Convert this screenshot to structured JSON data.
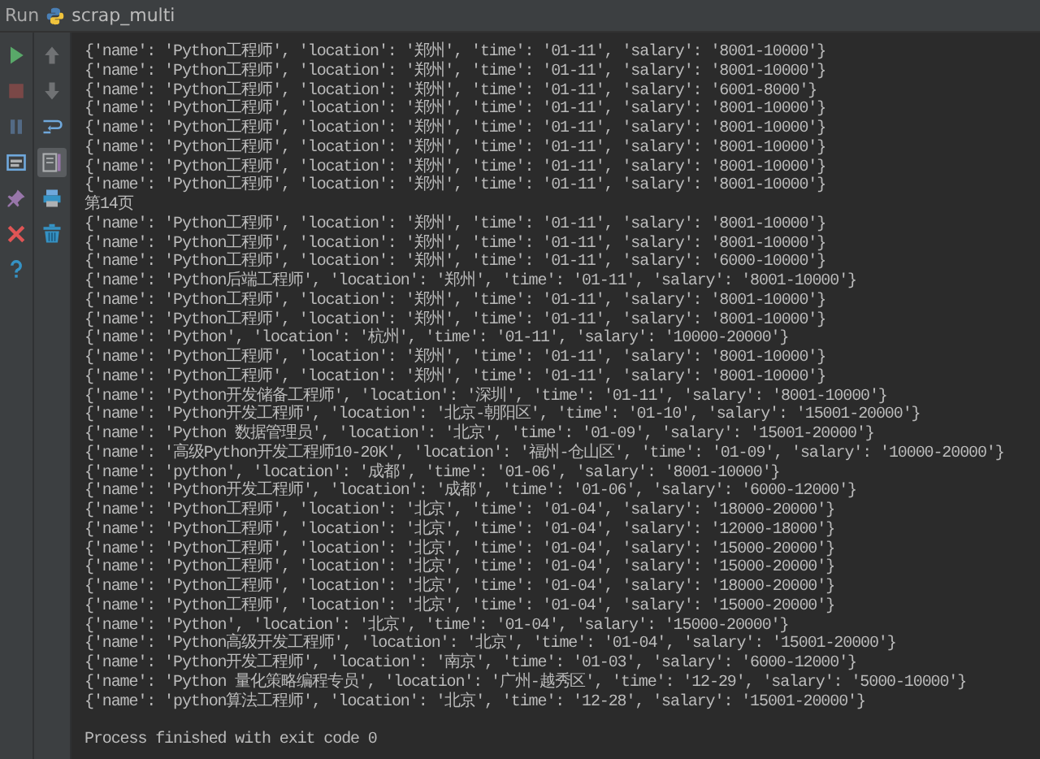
{
  "header": {
    "label": "Run",
    "config": "scrap_multi"
  },
  "toolbar_main": [
    {
      "kind": "run",
      "disabled": false,
      "on": false
    },
    {
      "kind": "stop",
      "disabled": true,
      "on": false
    },
    {
      "kind": "pause",
      "disabled": true,
      "on": false
    },
    {
      "kind": "layout",
      "disabled": false,
      "on": false
    },
    {
      "kind": "pin",
      "disabled": false,
      "on": false
    },
    {
      "kind": "close",
      "disabled": false,
      "on": false
    },
    {
      "kind": "help",
      "disabled": false,
      "on": false
    }
  ],
  "toolbar_side": [
    {
      "kind": "up",
      "disabled": true,
      "on": false
    },
    {
      "kind": "down",
      "disabled": true,
      "on": false
    },
    {
      "kind": "wrap",
      "disabled": false,
      "on": false
    },
    {
      "kind": "scroll",
      "disabled": false,
      "on": true
    },
    {
      "kind": "print",
      "disabled": false,
      "on": false
    },
    {
      "kind": "trash",
      "disabled": false,
      "on": false
    }
  ],
  "output": [
    "{'name': 'Python工程师', 'location': '郑州', 'time': '01-11', 'salary': '8001-10000'}",
    "{'name': 'Python工程师', 'location': '郑州', 'time': '01-11', 'salary': '8001-10000'}",
    "{'name': 'Python工程师', 'location': '郑州', 'time': '01-11', 'salary': '6001-8000'}",
    "{'name': 'Python工程师', 'location': '郑州', 'time': '01-11', 'salary': '8001-10000'}",
    "{'name': 'Python工程师', 'location': '郑州', 'time': '01-11', 'salary': '8001-10000'}",
    "{'name': 'Python工程师', 'location': '郑州', 'time': '01-11', 'salary': '8001-10000'}",
    "{'name': 'Python工程师', 'location': '郑州', 'time': '01-11', 'salary': '8001-10000'}",
    "{'name': 'Python工程师', 'location': '郑州', 'time': '01-11', 'salary': '8001-10000'}",
    "第14页",
    "{'name': 'Python工程师', 'location': '郑州', 'time': '01-11', 'salary': '8001-10000'}",
    "{'name': 'Python工程师', 'location': '郑州', 'time': '01-11', 'salary': '8001-10000'}",
    "{'name': 'Python工程师', 'location': '郑州', 'time': '01-11', 'salary': '6000-10000'}",
    "{'name': 'Python后端工程师', 'location': '郑州', 'time': '01-11', 'salary': '8001-10000'}",
    "{'name': 'Python工程师', 'location': '郑州', 'time': '01-11', 'salary': '8001-10000'}",
    "{'name': 'Python工程师', 'location': '郑州', 'time': '01-11', 'salary': '8001-10000'}",
    "{'name': 'Python', 'location': '杭州', 'time': '01-11', 'salary': '10000-20000'}",
    "{'name': 'Python工程师', 'location': '郑州', 'time': '01-11', 'salary': '8001-10000'}",
    "{'name': 'Python工程师', 'location': '郑州', 'time': '01-11', 'salary': '8001-10000'}",
    "{'name': 'Python开发储备工程师', 'location': '深圳', 'time': '01-11', 'salary': '8001-10000'}",
    "{'name': 'Python开发工程师', 'location': '北京-朝阳区', 'time': '01-10', 'salary': '15001-20000'}",
    "{'name': 'Python 数据管理员', 'location': '北京', 'time': '01-09', 'salary': '15001-20000'}",
    "{'name': '高级Python开发工程师10-20K', 'location': '福州-仓山区', 'time': '01-09', 'salary': '10000-20000'}",
    "{'name': 'python', 'location': '成都', 'time': '01-06', 'salary': '8001-10000'}",
    "{'name': 'Python开发工程师', 'location': '成都', 'time': '01-06', 'salary': '6000-12000'}",
    "{'name': 'Python工程师', 'location': '北京', 'time': '01-04', 'salary': '18000-20000'}",
    "{'name': 'Python工程师', 'location': '北京', 'time': '01-04', 'salary': '12000-18000'}",
    "{'name': 'Python工程师', 'location': '北京', 'time': '01-04', 'salary': '15000-20000'}",
    "{'name': 'Python工程师', 'location': '北京', 'time': '01-04', 'salary': '15000-20000'}",
    "{'name': 'Python工程师', 'location': '北京', 'time': '01-04', 'salary': '18000-20000'}",
    "{'name': 'Python工程师', 'location': '北京', 'time': '01-04', 'salary': '15000-20000'}",
    "{'name': 'Python', 'location': '北京', 'time': '01-04', 'salary': '15000-20000'}",
    "{'name': 'Python高级开发工程师', 'location': '北京', 'time': '01-04', 'salary': '15001-20000'}",
    "{'name': 'Python开发工程师', 'location': '南京', 'time': '01-03', 'salary': '6000-12000'}",
    "{'name': 'Python 量化策略编程专员', 'location': '广州-越秀区', 'time': '12-29', 'salary': '5000-10000'}",
    "{'name': 'python算法工程师', 'location': '北京', 'time': '12-28', 'salary': '15001-20000'}"
  ],
  "exit_message": "Process finished with exit code 0"
}
